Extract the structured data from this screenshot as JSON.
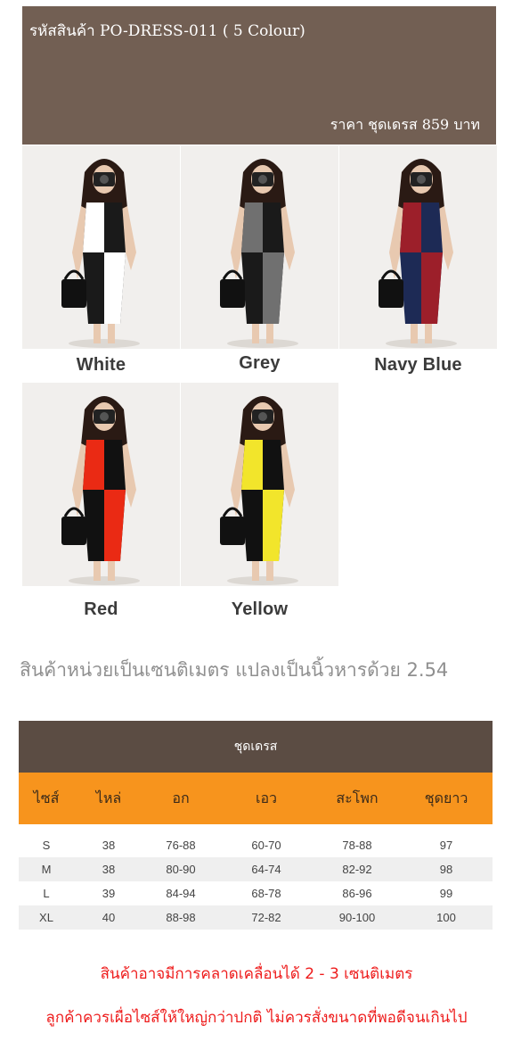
{
  "header": {
    "product_code": "รหัสสินค้า PO-DRESS-011 ( 5 Colour)",
    "price": "ราคา ชุดเดรส 859 บาท"
  },
  "colors": [
    {
      "label": "White",
      "top": "#ffffff",
      "bottom": "#1a1a1a"
    },
    {
      "label": "Grey",
      "top": "#707070",
      "bottom": "#1a1a1a"
    },
    {
      "label": "Navy Blue",
      "top": "#9c1f2a",
      "bottom": "#1d2a55"
    },
    {
      "label": "Red",
      "top": "#ea2a14",
      "bottom": "#111111"
    },
    {
      "label": "Yellow",
      "top": "#f2e52b",
      "bottom": "#111111"
    }
  ],
  "unit_note": "สินค้าหน่วยเป็นเซนติเมตร แปลงเป็นนิ้วหารด้วย 2.54",
  "size_table": {
    "title": "ชุดเดรส",
    "headers": [
      "ไซส์",
      "ไหล่",
      "อก",
      "เอว",
      "สะโพก",
      "ชุดยาว"
    ],
    "rows": [
      [
        "S",
        "38",
        "76-88",
        "60-70",
        "78-88",
        "97"
      ],
      [
        "M",
        "38",
        "80-90",
        "64-74",
        "82-92",
        "98"
      ],
      [
        "L",
        "39",
        "84-94",
        "68-78",
        "86-96",
        "99"
      ],
      [
        "XL",
        "40",
        "88-98",
        "72-82",
        "90-100",
        "100"
      ]
    ]
  },
  "warnings": {
    "line1": "สินค้าอาจมีการคลาดเคลื่อนได้ 2 - 3 เซนติเมตร",
    "line2": "ลูกค้าควรเผื่อไซส์ให้ใหญ่กว่าปกติ ไม่ควรสั่งขนาดที่พอดีจนเกินไป"
  }
}
